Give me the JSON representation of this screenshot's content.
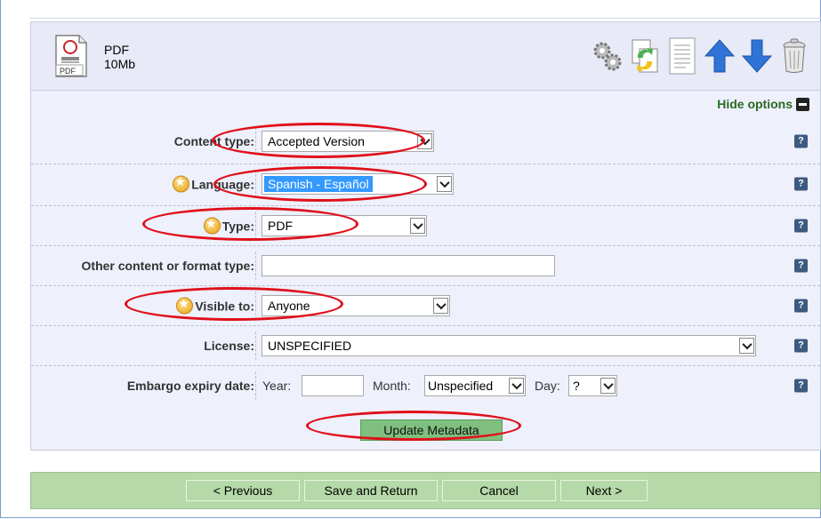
{
  "file": {
    "type_label": "PDF",
    "size": "10Mb",
    "icon_text": "PDF"
  },
  "toolbar": {
    "icons": [
      "gears-icon",
      "replace-file-icon",
      "document-list-icon",
      "arrow-up-icon",
      "arrow-down-icon",
      "trash-icon"
    ]
  },
  "hide_options": "Hide options",
  "fields": {
    "content_type": {
      "label": "Content type:",
      "value": "Accepted Version"
    },
    "language": {
      "label": "Language:",
      "value": "Spanish - Español"
    },
    "type": {
      "label": "Type:",
      "value": "PDF"
    },
    "other_format": {
      "label": "Other content or format type:",
      "value": ""
    },
    "visible_to": {
      "label": "Visible to:",
      "value": "Anyone"
    },
    "license": {
      "label": "License:",
      "value": "UNSPECIFIED"
    },
    "embargo": {
      "label": "Embargo expiry date:",
      "year_label": "Year:",
      "year_value": "",
      "month_label": "Month:",
      "month_value": "Unspecified",
      "day_label": "Day:",
      "day_value": "?"
    }
  },
  "help_glyph": "?",
  "update_button": "Update Metadata",
  "nav": {
    "previous": "< Previous",
    "save_return": "Save and Return",
    "cancel": "Cancel",
    "next": "Next >"
  },
  "colors": {
    "annotation": "#e0101a",
    "nav_bg": "#b5d9a9",
    "update_button": "#7fbf7f",
    "hide_options": "#2a6a22"
  }
}
